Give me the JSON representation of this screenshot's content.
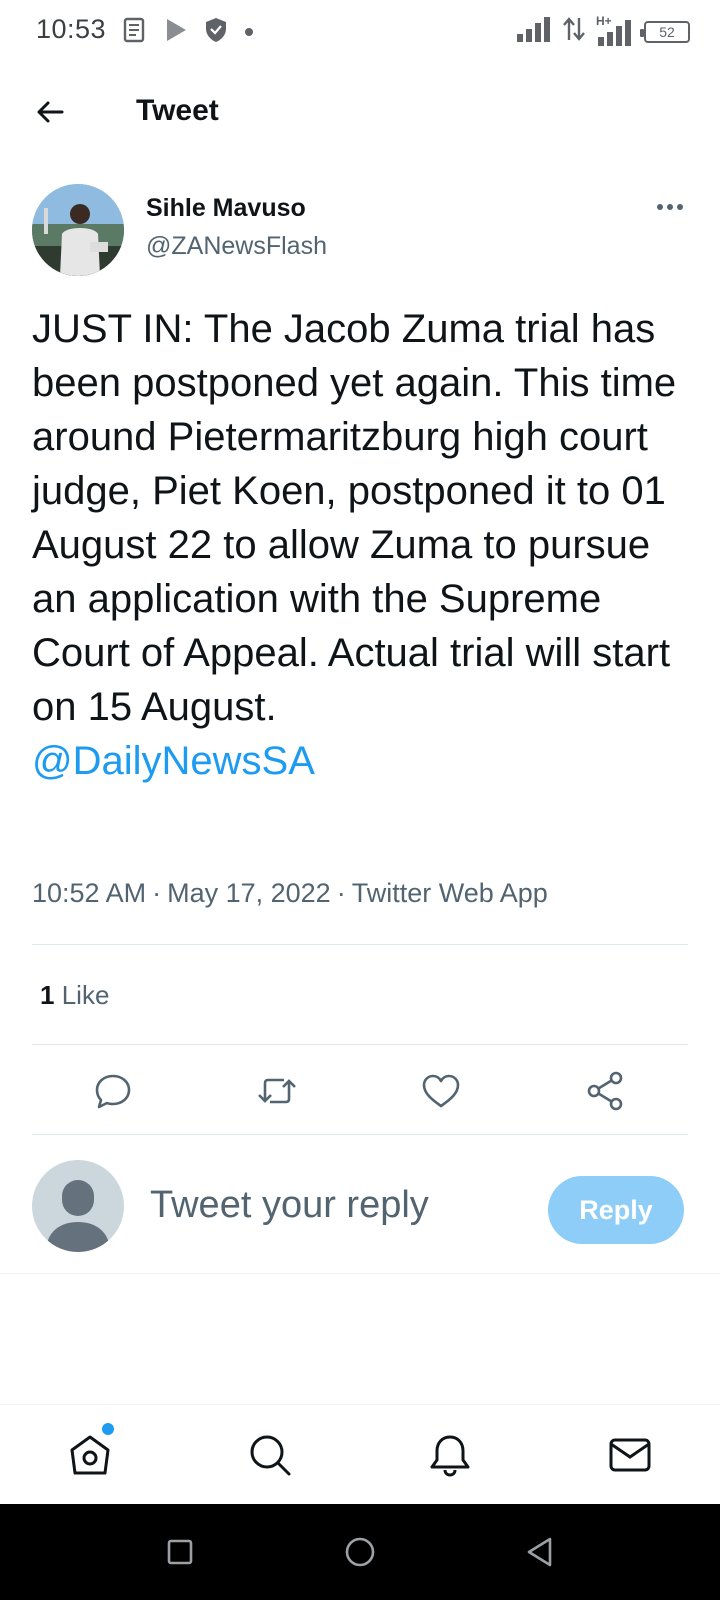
{
  "status_bar": {
    "time": "10:53",
    "icons_left": [
      "news-icon",
      "play-store-icon",
      "shield-icon",
      "dot-icon"
    ],
    "icons_right": [
      "signal-icon",
      "data-arrows-icon",
      "signal-hplus-icon",
      "battery-icon"
    ],
    "network_label": "H+",
    "battery_level": "52"
  },
  "header": {
    "title": "Tweet"
  },
  "author": {
    "name": "Sihle Mavuso",
    "handle": "@ZANewsFlash"
  },
  "tweet": {
    "text": "JUST IN: The Jacob Zuma trial has been postponed yet again. This time around Pietermaritzburg high court judge, Piet Koen, postponed it to 01 August 22 to allow Zuma to pursue an application with the Supreme Court of Appeal. Actual trial will start on 15 August.",
    "mention": "@DailyNewsSA",
    "time": "10:52 AM",
    "date": "May 17, 2022",
    "source": "Twitter Web App",
    "separator": "·",
    "like_count": "1",
    "like_label": "Like"
  },
  "actions": [
    "reply-icon",
    "retweet-icon",
    "like-icon",
    "share-icon"
  ],
  "reply": {
    "placeholder": "Tweet your reply",
    "button_label": "Reply"
  },
  "bottom_nav": [
    "home-icon",
    "search-icon",
    "notifications-icon",
    "messages-icon"
  ],
  "colors": {
    "accent": "#1d9bf0",
    "reply_button": "#8ecdf8",
    "secondary_text": "#536471"
  }
}
